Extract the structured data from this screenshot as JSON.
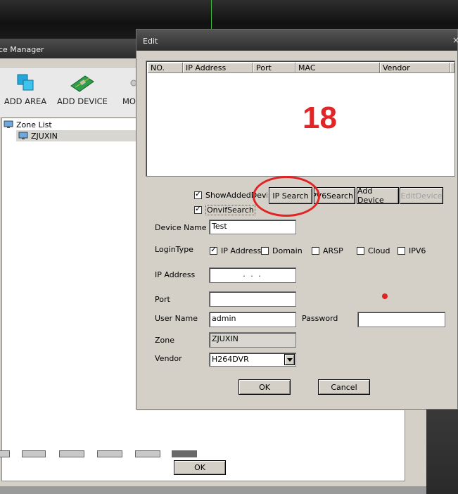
{
  "device_manager": {
    "title": "ce Manager",
    "toolbar": {
      "add_area": "ADD AREA",
      "add_device": "ADD DEVICE",
      "more": "MO"
    },
    "zone_list": {
      "root": "Zone List",
      "items": [
        "ZJUXIN"
      ]
    },
    "ok_label": "OK"
  },
  "edit_dialog": {
    "title": "Edit",
    "close": "×",
    "table": {
      "columns": [
        "NO.",
        "IP Address",
        "Port",
        "MAC",
        "Vendor"
      ],
      "rows": []
    },
    "annotation_count": "18",
    "show_added_device": {
      "label": "ShowAddedDevice",
      "checked": true
    },
    "onvif_search": {
      "label": "OnvifSearch",
      "checked": true
    },
    "buttons": {
      "ip_search": "IP Search",
      "ipv6_search": "IPV6Search",
      "add_device": "Add Device",
      "edit_device": "EditDevice"
    },
    "form": {
      "device_name_label": "Device Name",
      "device_name_value": "Test",
      "login_type_label": "LoginType",
      "login_types": [
        {
          "label": "IP Address",
          "checked": true
        },
        {
          "label": "Domain",
          "checked": false
        },
        {
          "label": "ARSP",
          "checked": false
        },
        {
          "label": "Cloud",
          "checked": false
        },
        {
          "label": "IPV6",
          "checked": false
        }
      ],
      "ip_address_label": "IP Address",
      "ip_address_value": ".    .    .",
      "port_label": "Port",
      "port_value": "",
      "user_name_label": "User Name",
      "user_name_value": "admin",
      "password_label": "Password",
      "password_value": "",
      "zone_label": "Zone",
      "zone_value": "ZJUXIN",
      "vendor_label": "Vendor",
      "vendor_value": "H264DVR"
    },
    "ok_label": "OK",
    "cancel_label": "Cancel"
  },
  "colors": {
    "annotation_red": "#e02626",
    "dialog_bg": "#d4d0c8",
    "titlebar": "#2e2e2e"
  }
}
